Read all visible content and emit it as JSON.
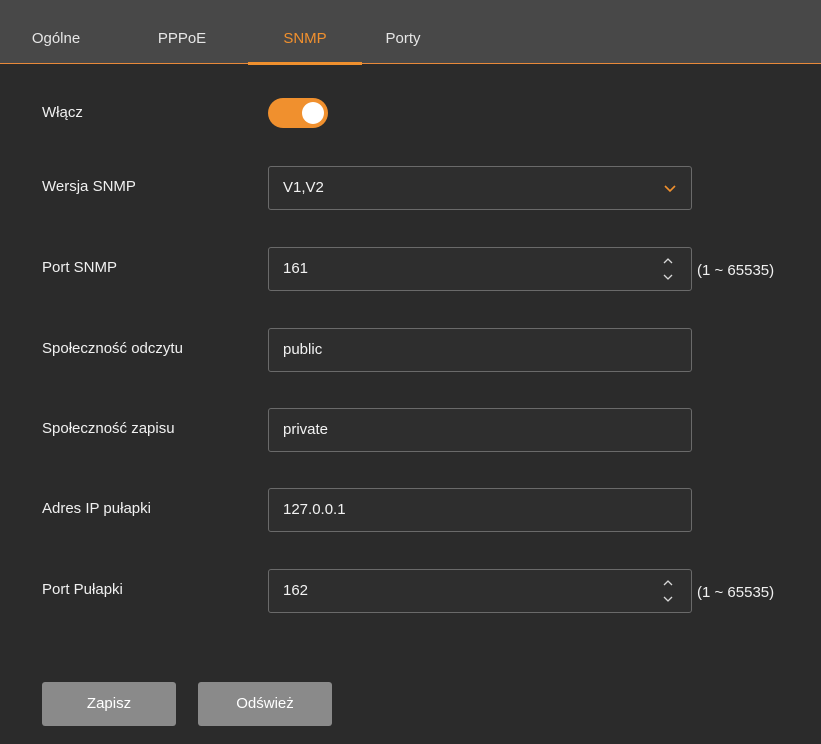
{
  "tabs": {
    "general": "Ogólne",
    "pppoe": "PPPoE",
    "snmp": "SNMP",
    "ports": "Porty",
    "active": "SNMP"
  },
  "form": {
    "enable": {
      "label": "Włącz",
      "value": true
    },
    "snmp_version": {
      "label": "Wersja SNMP",
      "value": "V1,V2"
    },
    "snmp_port": {
      "label": "Port SNMP",
      "value": "161",
      "range": "(1 ~ 65535)"
    },
    "read_community": {
      "label": "Społeczność odczytu",
      "value": "public"
    },
    "write_community": {
      "label": "Społeczność zapisu",
      "value": "private"
    },
    "trap_ip": {
      "label": "Adres IP pułapki",
      "value": "127.0.0.1"
    },
    "trap_port": {
      "label": "Port Pułapki",
      "value": "162",
      "range": "(1 ~ 65535)"
    }
  },
  "buttons": {
    "save": "Zapisz",
    "refresh": "Odśwież"
  },
  "colors": {
    "accent": "#f0902e",
    "background": "#2b2b2b",
    "tabbar": "#484848",
    "button": "#8a8a8a"
  },
  "icons": {
    "dropdown": "chevron-down-icon",
    "spinner": "spinner-arrows-icon"
  }
}
